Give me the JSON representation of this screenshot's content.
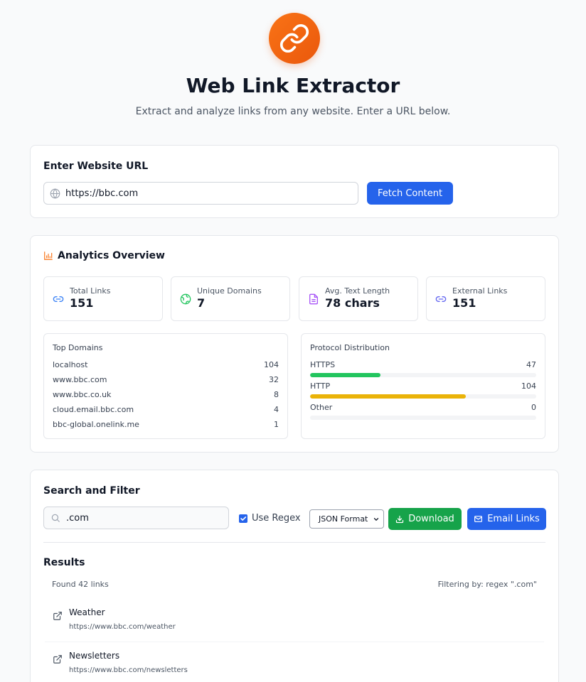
{
  "header": {
    "title": "Web Link Extractor",
    "subtitle": "Extract and analyze links from any website. Enter a URL below."
  },
  "url_section": {
    "title": "Enter Website URL",
    "url_value": "https://bbc.com",
    "fetch_label": "Fetch Content"
  },
  "analytics": {
    "title": "Analytics Overview",
    "stats": [
      {
        "label": "Total Links",
        "value": "151",
        "icon": "link-icon",
        "color": "#3b82f6"
      },
      {
        "label": "Unique Domains",
        "value": "7",
        "icon": "globe-icon",
        "color": "#22c55e"
      },
      {
        "label": "Avg. Text Length",
        "value": "78 chars",
        "icon": "document-icon",
        "color": "#a855f7"
      },
      {
        "label": "External Links",
        "value": "151",
        "icon": "link-icon",
        "color": "#6366f1"
      }
    ],
    "top_domains": {
      "title": "Top Domains",
      "rows": [
        {
          "domain": "localhost",
          "count": "104"
        },
        {
          "domain": "www.bbc.com",
          "count": "32"
        },
        {
          "domain": "www.bbc.co.uk",
          "count": "8"
        },
        {
          "domain": "cloud.email.bbc.com",
          "count": "4"
        },
        {
          "domain": "bbc-global.onelink.me",
          "count": "1"
        }
      ]
    },
    "protocols": {
      "title": "Protocol Distribution",
      "rows": [
        {
          "name": "HTTPS",
          "count": "47",
          "fraction": 0.31,
          "color": "#22c55e"
        },
        {
          "name": "HTTP",
          "count": "104",
          "fraction": 0.69,
          "color": "#eab308"
        },
        {
          "name": "Other",
          "count": "0",
          "fraction": 0,
          "color": "#9ca3af"
        }
      ]
    }
  },
  "search": {
    "title": "Search and Filter",
    "query": ".com",
    "use_regex_label": "Use Regex",
    "use_regex_checked": true,
    "format_selected": "JSON Format",
    "download_label": "Download",
    "email_label": "Email Links"
  },
  "results": {
    "title": "Results",
    "found_text": "Found 42 links",
    "filter_text": "Filtering by: regex \".com\"",
    "items": [
      {
        "title": "Weather",
        "url": "https://www.bbc.com/weather"
      },
      {
        "title": "Newsletters",
        "url": "https://www.bbc.com/newsletters"
      }
    ]
  },
  "colors": {
    "accent": "#2563eb",
    "logo": "#f97316",
    "download": "#16a34a"
  }
}
